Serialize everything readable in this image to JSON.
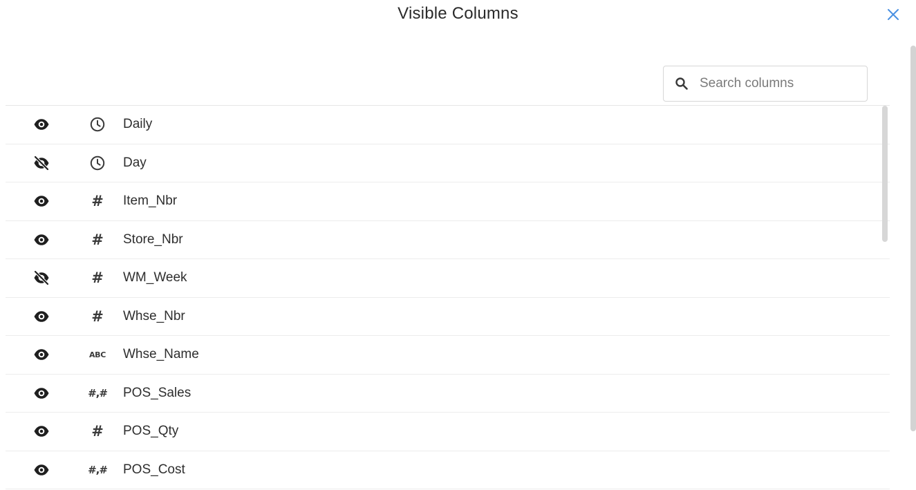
{
  "dialog": {
    "title": "Visible Columns",
    "close_icon": "close-icon",
    "accent_color": "#4a90e2"
  },
  "search": {
    "placeholder": "Search columns",
    "value": "",
    "icon": "search-icon"
  },
  "columns": [
    {
      "label": "Daily",
      "visible": true,
      "type": "datetime",
      "type_icon": "clock-icon"
    },
    {
      "label": "Day",
      "visible": false,
      "type": "datetime",
      "type_icon": "clock-icon"
    },
    {
      "label": "Item_Nbr",
      "visible": true,
      "type": "integer",
      "type_icon": "hash-icon"
    },
    {
      "label": "Store_Nbr",
      "visible": true,
      "type": "integer",
      "type_icon": "hash-icon"
    },
    {
      "label": "WM_Week",
      "visible": false,
      "type": "integer",
      "type_icon": "hash-icon"
    },
    {
      "label": "Whse_Nbr",
      "visible": true,
      "type": "integer",
      "type_icon": "hash-icon"
    },
    {
      "label": "Whse_Name",
      "visible": true,
      "type": "string",
      "type_icon": "abc-icon",
      "type_text": "ABC"
    },
    {
      "label": "POS_Sales",
      "visible": true,
      "type": "decimal",
      "type_icon": "decimal-icon",
      "type_text": "#,#"
    },
    {
      "label": "POS_Qty",
      "visible": true,
      "type": "integer",
      "type_icon": "hash-icon"
    },
    {
      "label": "POS_Cost",
      "visible": true,
      "type": "decimal",
      "type_icon": "decimal-icon",
      "type_text": "#,#"
    }
  ]
}
